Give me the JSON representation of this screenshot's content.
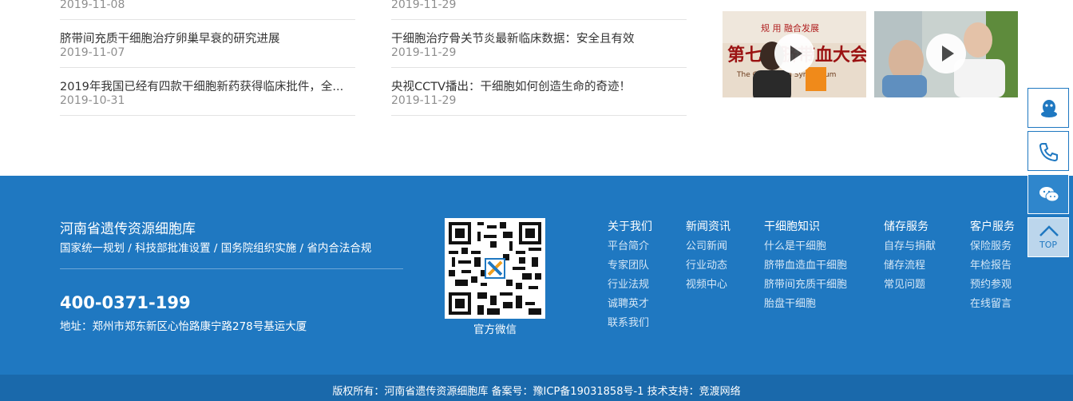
{
  "news_left": [
    {
      "title": "",
      "date": "2019-11-08"
    },
    {
      "title": "脐带间充质干细胞治疗卵巢早衰的研究进展",
      "date": "2019-11-07"
    },
    {
      "title": "2019年我国已经有四款干细胞新药获得临床批件，全...",
      "date": "2019-10-31"
    }
  ],
  "news_mid": [
    {
      "title": "",
      "date": "2019-11-29"
    },
    {
      "title": "干细胞治疗骨关节炎最新临床数据：安全且有效",
      "date": "2019-11-29"
    },
    {
      "title": "央视CCTV播出：干细胞如何创造生命的奇迹！",
      "date": "2019-11-29"
    }
  ],
  "videos": [
    {
      "icon": "play-icon",
      "banner_text": "第七届脐带血大会",
      "sub_text": "规   用  融合发展",
      "en_text": "The   Cord Blood Symposium"
    },
    {
      "icon": "play-icon"
    }
  ],
  "footer": {
    "title": "河南省遗传资源细胞库",
    "slogan": "国家统一规划  /  科技部批准设置  /  国务院组织实施  /  省内合法合规",
    "phone": "400-0371-199",
    "address": "地址：郑州市郑东新区心怡路康宁路278号基运大厦",
    "qr_caption": "官方微信",
    "nav": [
      {
        "head": "关于我们",
        "links": [
          "平台简介",
          "专家团队",
          "行业法规",
          "诚聘英才",
          "联系我们"
        ]
      },
      {
        "head": "新闻资讯",
        "links": [
          "公司新闻",
          "行业动态",
          "视频中心"
        ]
      },
      {
        "head": "干细胞知识",
        "links": [
          "什么是干细胞",
          "脐带血造血干细胞",
          "脐带间充质干细胞",
          "胎盘干细胞"
        ]
      },
      {
        "head": "储存服务",
        "links": [
          "自存与捐献",
          "储存流程",
          "常见问题"
        ]
      },
      {
        "head": "客户服务",
        "links": [
          "保险服务",
          "年检报告",
          "预约参观",
          "在线留言"
        ]
      }
    ],
    "copyright": "版权所有：河南省遗传资源细胞库    备案号：豫ICP备19031858号-1    技术支持：竞渡网络"
  },
  "side_bar": {
    "items": [
      "qq-icon",
      "phone-icon",
      "wechat-icon",
      "back-to-top-icon"
    ],
    "top_label": "TOP"
  },
  "colors": {
    "footer_bg": "#1f78c1",
    "copyright_bg": "#1a69ab",
    "accent": "#1f78c1"
  }
}
